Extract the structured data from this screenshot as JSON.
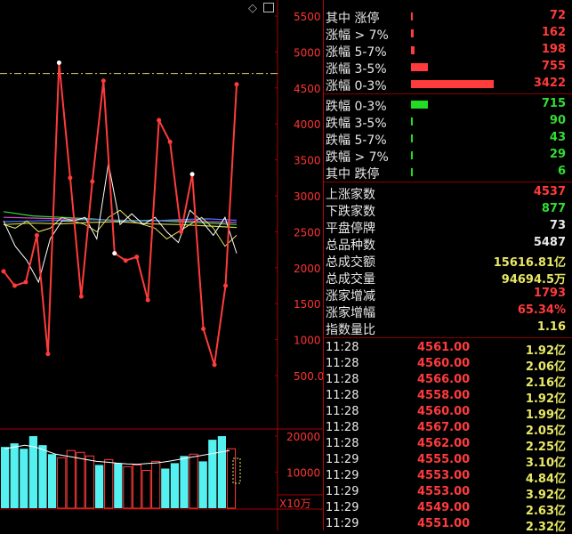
{
  "chart": {
    "y_axis_ticks": [
      "5500",
      "5000",
      "4500",
      "4000",
      "3500",
      "3000",
      "2500",
      "2000",
      "1500",
      "1000",
      "500.0"
    ],
    "y_axis_values": [
      5500,
      5000,
      4500,
      4000,
      3500,
      3000,
      2500,
      2000,
      1500,
      1000,
      500
    ],
    "reference_level": 4700,
    "main_series": [
      1950,
      1750,
      1800,
      2450,
      800,
      4850,
      3250,
      1600,
      3200,
      4600,
      2200,
      2100,
      2150,
      1550,
      4050,
      3750,
      2500,
      3300,
      1150,
      650,
      1750,
      4550
    ],
    "white_series": [
      2650,
      2300,
      2100,
      1800,
      2400,
      2650,
      2650,
      2700,
      2400,
      3450,
      2600,
      2750,
      2600,
      2700,
      2500,
      2350,
      2800,
      2650,
      2450,
      2700,
      2200
    ],
    "yellow_series": [
      2600,
      2550,
      2650,
      2500,
      2550,
      2700,
      2650,
      2600,
      2500,
      2700,
      2800,
      2650,
      2600,
      2550,
      2400,
      2500,
      2600,
      2700,
      2550,
      2300,
      2450
    ],
    "volume_ticks": [
      "20000",
      "10000"
    ],
    "volume_unit": "X10万",
    "volume_values": [
      17000,
      18000,
      16500,
      20000,
      17500,
      15000,
      14000,
      16000,
      15500,
      14500,
      12000,
      13500,
      12500,
      11500,
      12000,
      10500,
      13000,
      11000,
      12500,
      14500,
      15000,
      13000,
      19000,
      20000,
      16500
    ]
  },
  "icons": {
    "diamond": "diamond-icon",
    "window": "window-icon"
  },
  "stats_up": [
    {
      "label": "其中 涨停",
      "value": "72",
      "bar_pct": 0.01
    },
    {
      "label": "涨幅 > 7%",
      "value": "162",
      "bar_pct": 0.03
    },
    {
      "label": "涨幅 5-7%",
      "value": "198",
      "bar_pct": 0.04
    },
    {
      "label": "涨幅 3-5%",
      "value": "755",
      "bar_pct": 0.2
    },
    {
      "label": "涨幅 0-3%",
      "value": "3422",
      "bar_pct": 0.97
    }
  ],
  "stats_down": [
    {
      "label": "跌幅 0-3%",
      "value": "715",
      "bar_pct": 0.2
    },
    {
      "label": "跌幅 3-5%",
      "value": "90",
      "bar_pct": 0.025
    },
    {
      "label": "跌幅 5-7%",
      "value": "43",
      "bar_pct": 0.01
    },
    {
      "label": "跌幅 > 7%",
      "value": "29",
      "bar_pct": 0.01
    },
    {
      "label": "其中 跌停",
      "value": "6",
      "bar_pct": 0.005
    }
  ],
  "summary": [
    {
      "label": "上涨家数",
      "value": "4537",
      "color": "#ff3b3b"
    },
    {
      "label": "下跌家数",
      "value": "877",
      "color": "#33dd33"
    },
    {
      "label": "平盘停牌",
      "value": "73",
      "color": "#e8e8e8"
    },
    {
      "label": "总品种数",
      "value": "5487",
      "color": "#e8e8e8"
    },
    {
      "label": "总成交额",
      "value": "15616.81亿",
      "color": "#e8e866"
    },
    {
      "label": "总成交量",
      "value": "94694.5万",
      "color": "#e8e866"
    },
    {
      "label": "涨家增减",
      "value": "1793",
      "color": "#ff3b3b"
    },
    {
      "label": "涨家增幅",
      "value": "65.34%",
      "color": "#ff3b3b"
    },
    {
      "label": "指数量比",
      "value": "1.16",
      "color": "#e8e866"
    }
  ],
  "ticks": [
    {
      "time": "11:28",
      "price": "4561.00",
      "vol": "1.92亿"
    },
    {
      "time": "11:28",
      "price": "4560.00",
      "vol": "2.06亿"
    },
    {
      "time": "11:28",
      "price": "4566.00",
      "vol": "2.16亿"
    },
    {
      "time": "11:28",
      "price": "4558.00",
      "vol": "1.92亿"
    },
    {
      "time": "11:28",
      "price": "4560.00",
      "vol": "1.99亿"
    },
    {
      "time": "11:28",
      "price": "4567.00",
      "vol": "2.05亿"
    },
    {
      "time": "11:28",
      "price": "4562.00",
      "vol": "2.25亿"
    },
    {
      "time": "11:29",
      "price": "4555.00",
      "vol": "3.10亿"
    },
    {
      "time": "11:29",
      "price": "4553.00",
      "vol": "4.84亿"
    },
    {
      "time": "11:29",
      "price": "4553.00",
      "vol": "3.92亿"
    },
    {
      "time": "11:29",
      "price": "4549.00",
      "vol": "2.63亿"
    },
    {
      "time": "11:29",
      "price": "4551.00",
      "vol": "2.32亿"
    }
  ]
}
